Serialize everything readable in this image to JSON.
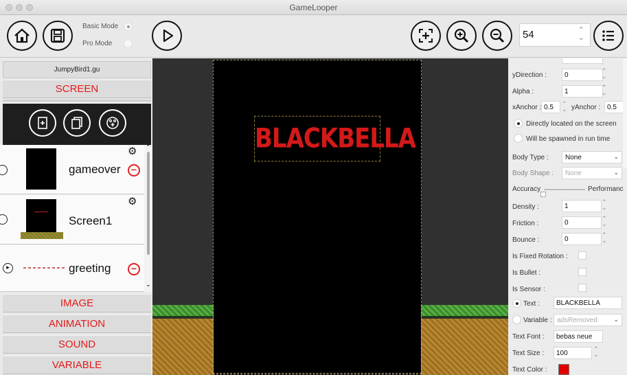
{
  "window": {
    "title": "GameLooper"
  },
  "toolbar": {
    "basic_mode_label": "Basic Mode",
    "pro_mode_label": "Pro Mode",
    "zoom_value": "54"
  },
  "left_panel": {
    "file_name": "JumpyBird1.gu",
    "screen_header": "SCREEN",
    "screens": [
      {
        "name": "gameover"
      },
      {
        "name": "Screen1"
      },
      {
        "name": "greeting"
      }
    ],
    "categories": [
      "IMAGE",
      "ANIMATION",
      "SOUND",
      "VARIABLE"
    ]
  },
  "canvas": {
    "text_object": "BLACKBELLA"
  },
  "properties": {
    "ydirection_label": "yDirection :",
    "ydirection_value": "0",
    "alpha_label": "Alpha :",
    "alpha_value": "1",
    "xanchor_label": "xAnchor :",
    "xanchor_value": "0.5",
    "yanchor_label": "yAnchor :",
    "yanchor_value": "0.5",
    "located_label": "Directly located on the screen",
    "spawned_label": "Will be spawned in run time",
    "body_type_label": "Body Type :",
    "body_type_value": "None",
    "body_shape_label": "Body Shape :",
    "body_shape_value": "None",
    "accuracy_label": "Accuracy",
    "performance_label": "Performanc",
    "density_label": "Density :",
    "density_value": "1",
    "friction_label": "Friction :",
    "friction_value": "0",
    "bounce_label": "Bounce :",
    "bounce_value": "0",
    "fixed_rotation_label": "Is Fixed Rotation :",
    "bullet_label": "Is Bullet :",
    "sensor_label": "Is Sensor :",
    "text_label": "Text :",
    "text_value": "BLACKBELLA",
    "variable_label": "Variable :",
    "variable_value": "adsRemoved",
    "text_font_label": "Text Font :",
    "text_font_value": "bebas neue",
    "text_size_label": "Text Size :",
    "text_size_value": "100",
    "text_color_label": "Text Color :",
    "text_color_value": "#e00000"
  }
}
